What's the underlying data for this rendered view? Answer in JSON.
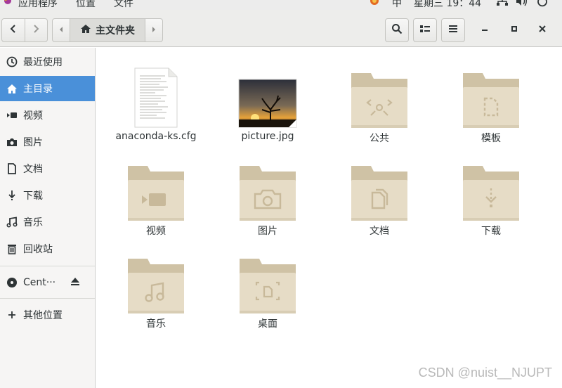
{
  "topbar": {
    "apps_menu": "应用程序",
    "places_menu": "位置",
    "file_menu": "文件",
    "input_method": "中",
    "clock": "星期三 19：44"
  },
  "headerbar": {
    "breadcrumb_home": "主文件夹"
  },
  "sidebar": {
    "items": [
      {
        "label": "最近使用",
        "icon": "clock-icon"
      },
      {
        "label": "主目录",
        "icon": "home-icon",
        "active": true
      },
      {
        "label": "视频",
        "icon": "video-icon"
      },
      {
        "label": "图片",
        "icon": "camera-icon"
      },
      {
        "label": "文档",
        "icon": "document-icon"
      },
      {
        "label": "下载",
        "icon": "download-icon"
      },
      {
        "label": "音乐",
        "icon": "music-icon"
      },
      {
        "label": "回收站",
        "icon": "trash-icon"
      }
    ],
    "device": {
      "label": "Cent···",
      "icon": "disc-icon"
    },
    "other_locations": {
      "label": "其他位置",
      "icon": "plus-icon"
    }
  },
  "files": [
    {
      "name": "anaconda-ks.cfg",
      "kind": "text-file"
    },
    {
      "name": "picture.jpg",
      "kind": "image-file"
    },
    {
      "name": "公共",
      "kind": "folder-public"
    },
    {
      "name": "模板",
      "kind": "folder-templates"
    },
    {
      "name": "视频",
      "kind": "folder-videos"
    },
    {
      "name": "图片",
      "kind": "folder-pictures"
    },
    {
      "name": "文档",
      "kind": "folder-documents"
    },
    {
      "name": "下载",
      "kind": "folder-downloads"
    },
    {
      "name": "音乐",
      "kind": "folder-music"
    },
    {
      "name": "桌面",
      "kind": "folder-desktop"
    }
  ],
  "watermark": "CSDN @nuist__NJUPT",
  "colors": {
    "accent": "#4a90d9",
    "folder_back": "#cfc2a5",
    "folder_front": "#e6dcc6",
    "folder_emblem": "#c8b99a"
  }
}
